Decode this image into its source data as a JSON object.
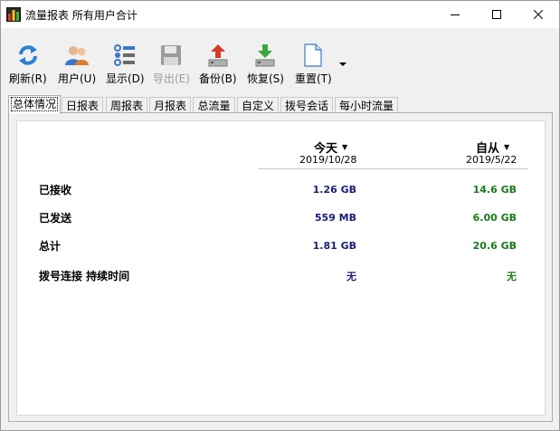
{
  "window": {
    "title": "流量报表 所有用户合计"
  },
  "toolbar": {
    "refresh": "刷新(R)",
    "users": "用户(U)",
    "display": "显示(D)",
    "export": "导出(E)",
    "backup": "备份(B)",
    "restore": "恢复(S)",
    "reset": "重置(T)"
  },
  "tabs": [
    "总体情况",
    "日报表",
    "周报表",
    "月报表",
    "总流量",
    "自定义",
    "拨号会话",
    "每小时流量"
  ],
  "summary": {
    "col_today": "今天",
    "col_today_date": "2019/10/28",
    "col_since": "自从",
    "col_since_date": "2019/5/22",
    "rows": [
      {
        "label": "已接收",
        "today": "1.26 GB",
        "since": "14.6 GB"
      },
      {
        "label": "已发送",
        "today": "559 MB",
        "since": "6.00 GB"
      },
      {
        "label": "总计",
        "today": "1.81 GB",
        "since": "20.6 GB"
      },
      {
        "label": "拨号连接 持续时间",
        "today": "无",
        "since": "无"
      }
    ]
  },
  "colors": {
    "today_value": "#1c1c7a",
    "since_value": "#1a7a1a"
  }
}
